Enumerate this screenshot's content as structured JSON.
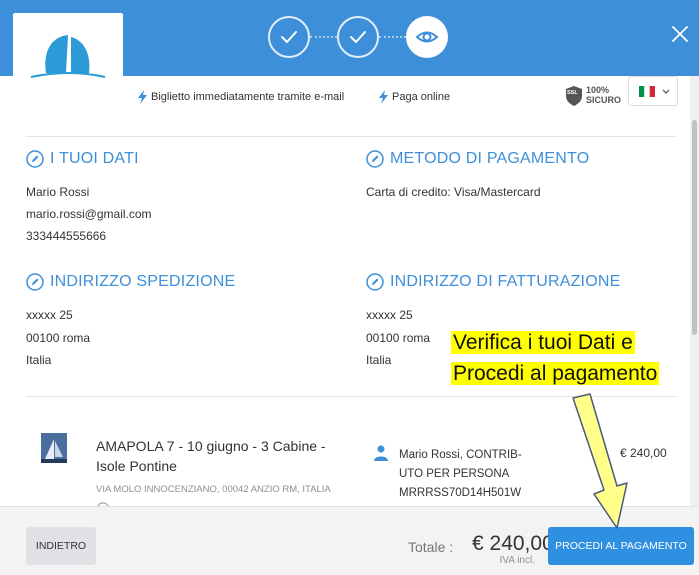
{
  "header": {
    "close_label": "×"
  },
  "infobar": {
    "ticket_email": "Biglietto immediatamente tramite e-mail",
    "pay_online": "Paga online",
    "secure_percent": "100%",
    "secure_label": "SICURO",
    "secure_badge": "SSL"
  },
  "sections": {
    "your_data": {
      "title": "I TUOI DATI",
      "name": "Mario Rossi",
      "email": "mario.rossi@gmail.com",
      "phone": "333444555666"
    },
    "payment_method": {
      "title": "METODO DI PAGAMENTO",
      "value": "Carta di credito: Visa/Mastercard"
    },
    "shipping_address": {
      "title": "INDIRIZZO SPEDIZIONE",
      "street": "xxxxx 25",
      "city": "00100 roma",
      "country": "Italia"
    },
    "billing_address": {
      "title": "INDIRIZZO DI FATTURAZIONE",
      "street": "xxxxx 25",
      "city": "00100 roma",
      "country": "Italia"
    }
  },
  "booking": {
    "title": "AMAPOLA 7 - 10 giugno - 3 Cabine - Isole Pontine",
    "address": "VIA MOLO INNOCENZIANO, 00042 ANZIO RM, ITALIA",
    "person_line1": "Mario Rossi, CONTRIB-",
    "person_line2": "UTO PER PERSONA",
    "person_line3": "MRRRSS70D14H501W",
    "price": "€ 240,00"
  },
  "footer": {
    "back_label": "INDIETRO",
    "total_label": "Totale :",
    "total_value": "€ 240,00",
    "vat_label": "IVA incl.",
    "pay_label": "PROCEDI AL PAGAMENTO"
  },
  "annotation": {
    "line1": "Verifica i tuoi Dati e",
    "line2": "Procedi al pagamento"
  },
  "colors": {
    "header_blue": "#3d8fd9",
    "button_blue": "#2f8fe0",
    "highlight": "#ffff00"
  }
}
